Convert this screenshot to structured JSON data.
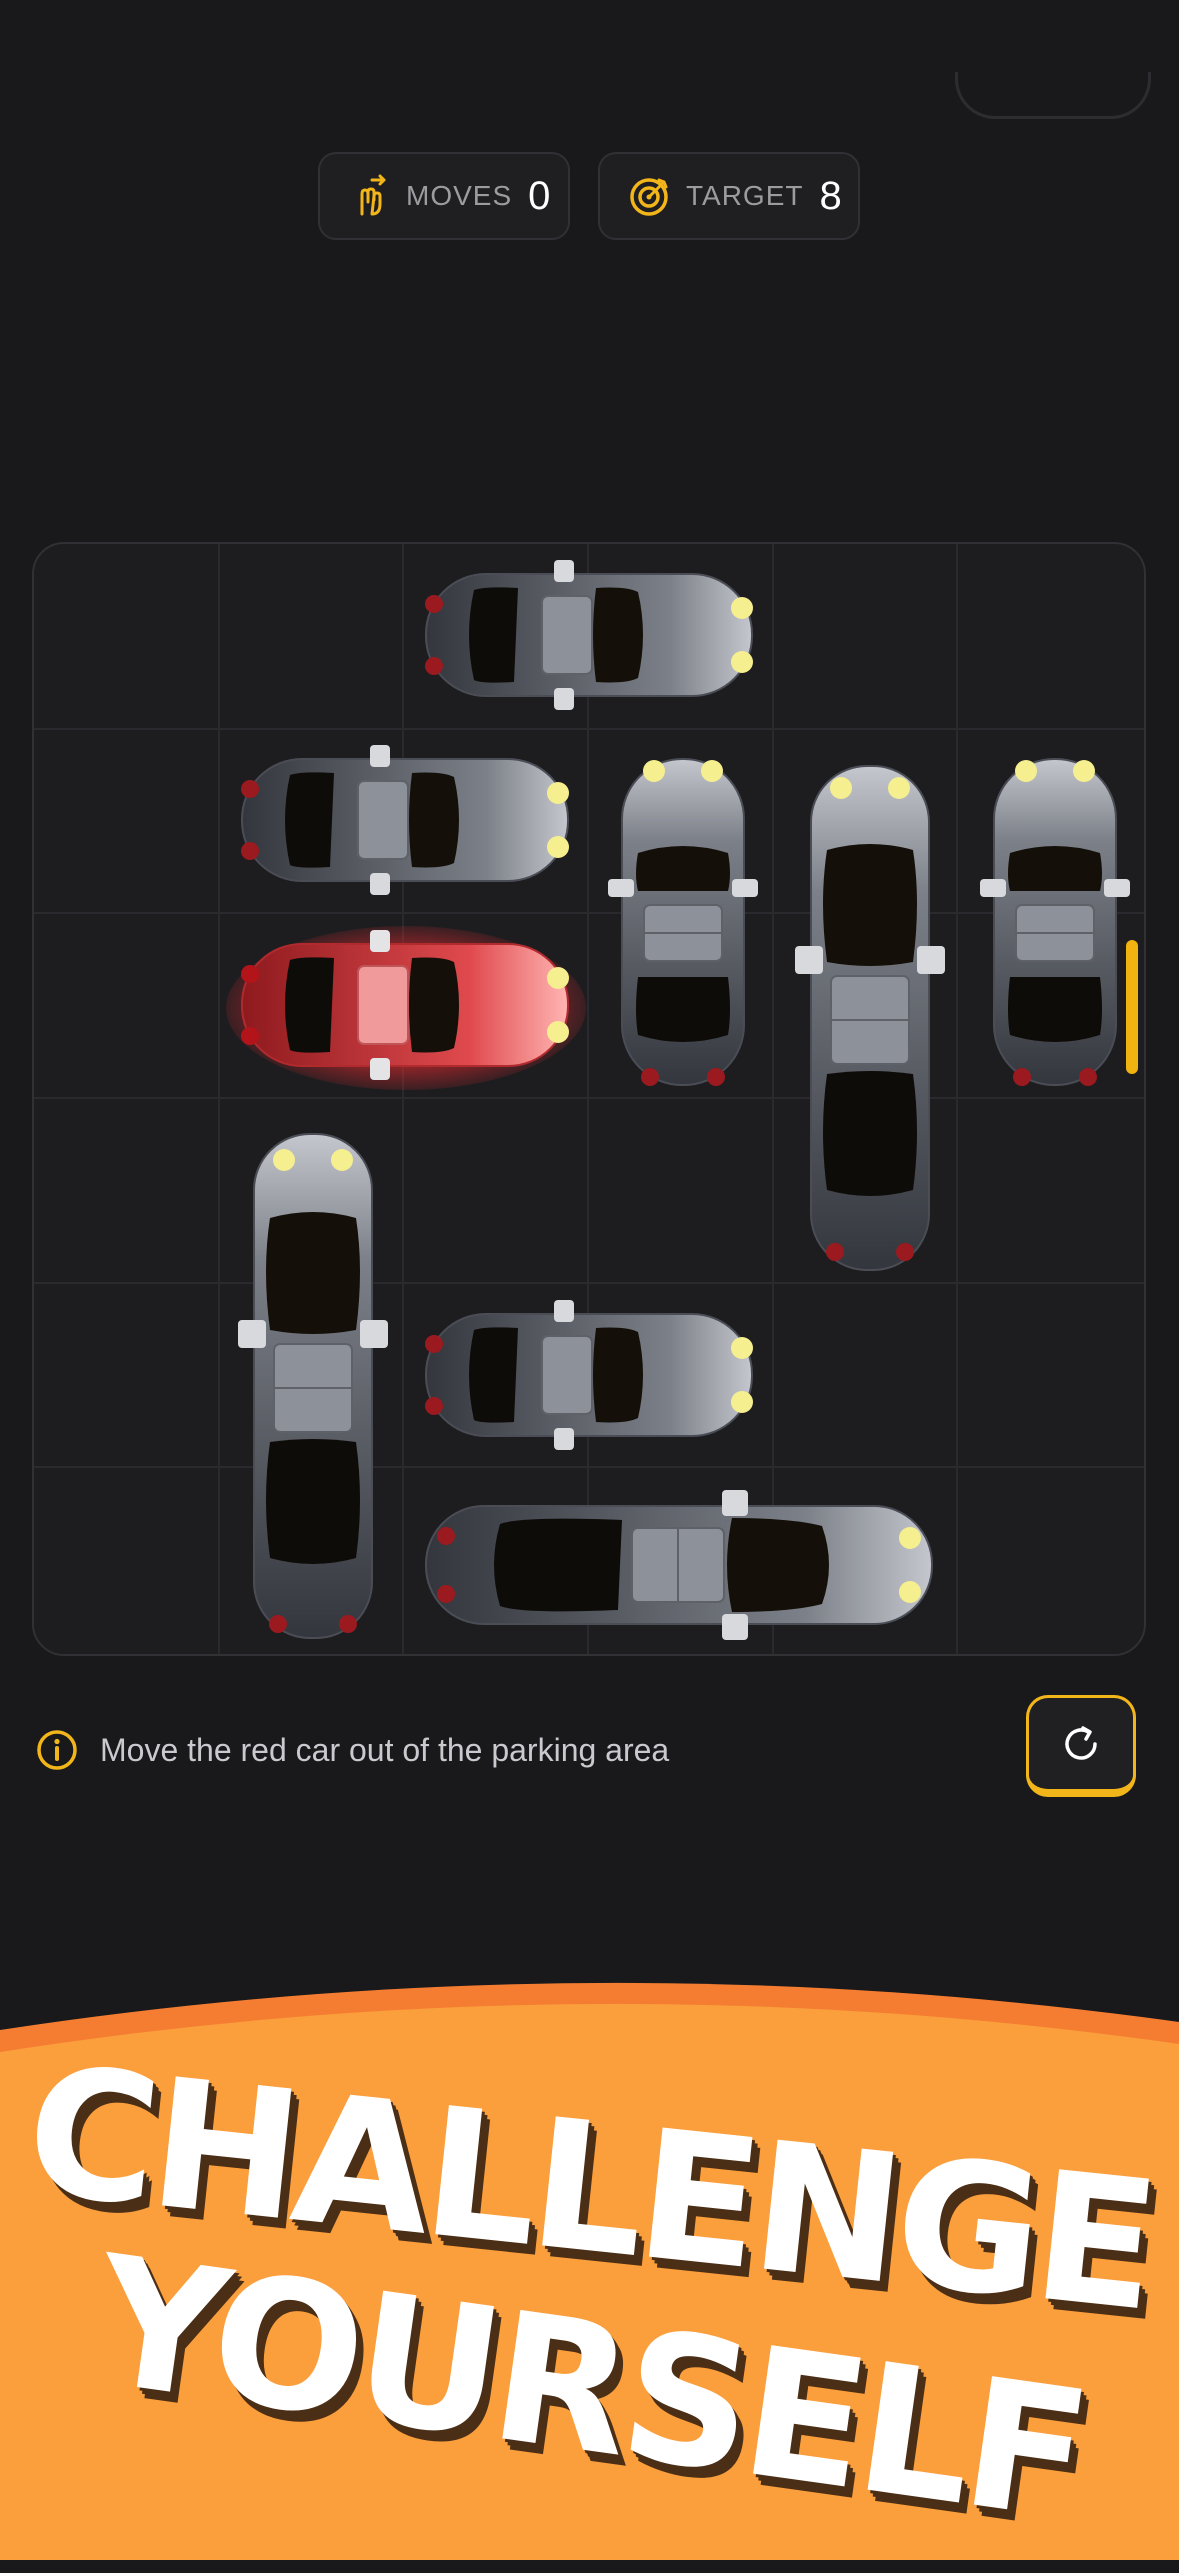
{
  "stats": {
    "moves_label": "MOVES",
    "moves_value": "0",
    "target_label": "TARGET",
    "target_value": "8"
  },
  "board": {
    "grid": "6x6",
    "cars": [
      {
        "id": "car-h-top",
        "orientation": "horizontal",
        "row": 1,
        "col": 3,
        "length": 2,
        "color": "silver"
      },
      {
        "id": "car-h-row2",
        "orientation": "horizontal",
        "row": 2,
        "col": 2,
        "length": 2,
        "color": "silver"
      },
      {
        "id": "car-red",
        "orientation": "horizontal",
        "row": 3,
        "col": 2,
        "length": 2,
        "color": "red"
      },
      {
        "id": "car-v-col4",
        "orientation": "vertical",
        "row": 2,
        "col": 4,
        "length": 2,
        "color": "silver"
      },
      {
        "id": "car-v-col5-long",
        "orientation": "vertical",
        "row": 2,
        "col": 5,
        "length": 3,
        "color": "silver"
      },
      {
        "id": "car-v-col6",
        "orientation": "vertical",
        "row": 2,
        "col": 6,
        "length": 2,
        "color": "silver"
      },
      {
        "id": "car-v-col2",
        "orientation": "vertical",
        "row": 4,
        "col": 2,
        "length": 3,
        "color": "silver"
      },
      {
        "id": "car-h-row5",
        "orientation": "horizontal",
        "row": 5,
        "col": 3,
        "length": 2,
        "color": "silver"
      },
      {
        "id": "car-h-row6-long",
        "orientation": "horizontal",
        "row": 6,
        "col": 3,
        "length": 3,
        "color": "silver"
      }
    ]
  },
  "hint": {
    "text": "Move the red car out of the parking area"
  },
  "banner": {
    "line1": "CHALLENGE",
    "line2": "YOURSELF"
  },
  "colors": {
    "background": "#19191b",
    "accent": "#f3b61a",
    "banner": "#fb9e3c",
    "red_car": "#d93a3f"
  }
}
